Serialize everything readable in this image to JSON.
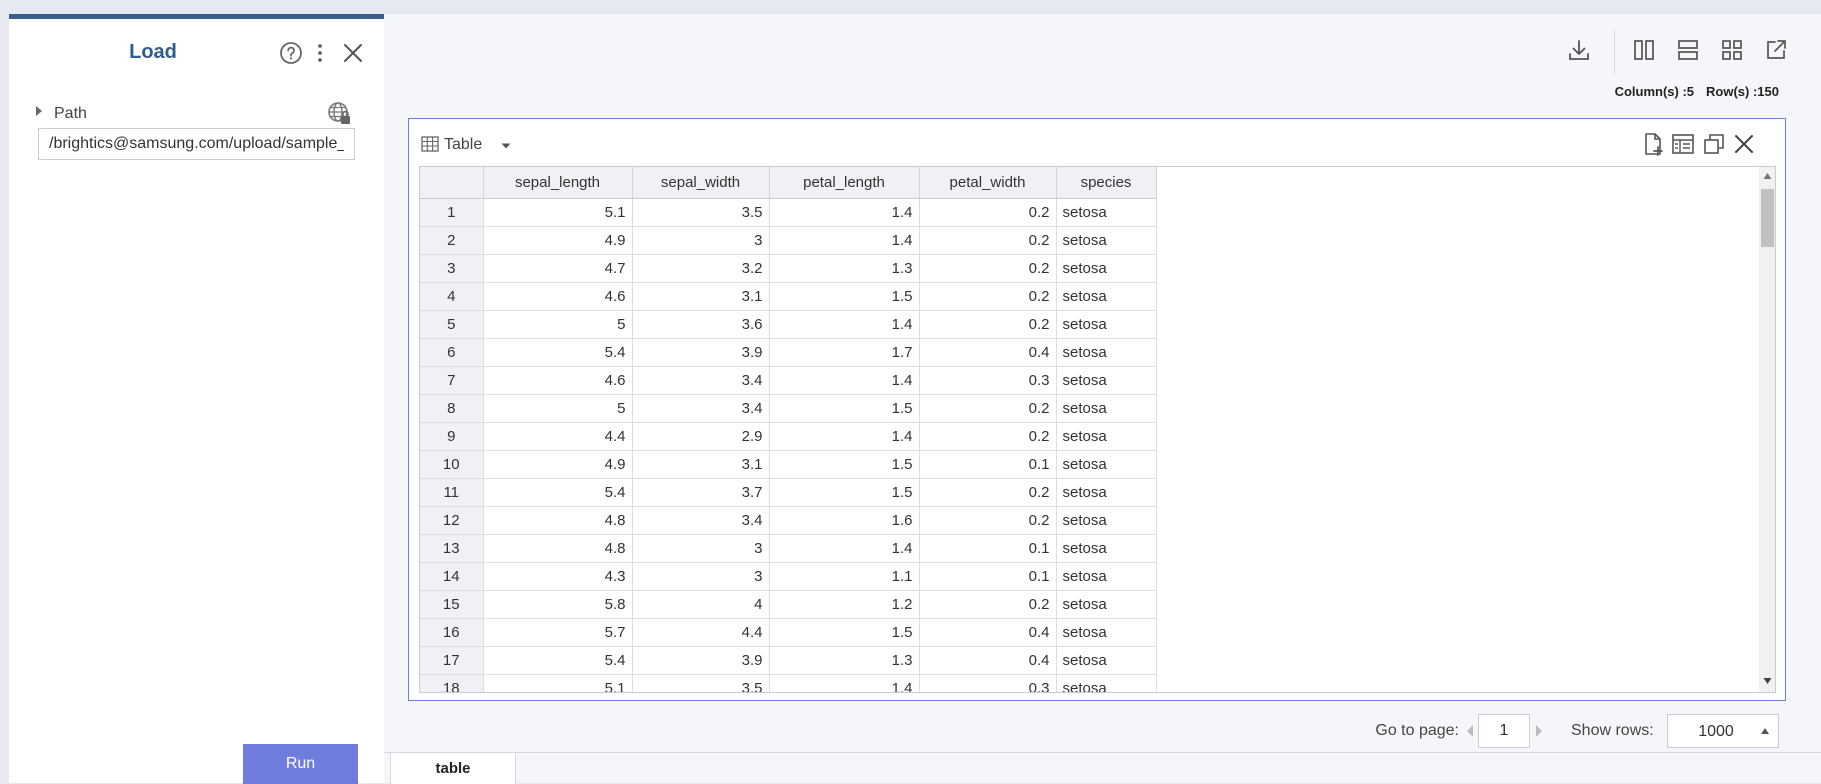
{
  "panel": {
    "title": "Load",
    "path_label": "Path",
    "path_value": "/brightics@samsung.com/upload/sample_iris.csv",
    "run_label": "Run"
  },
  "main": {
    "columns_info": "Column(s) :5",
    "rows_info": "Row(s) :150"
  },
  "table_view": {
    "type_label": "Table",
    "columns": [
      "sepal_length",
      "sepal_width",
      "petal_length",
      "petal_width",
      "species"
    ],
    "rows": [
      [
        "1",
        "5.1",
        "3.5",
        "1.4",
        "0.2",
        "setosa"
      ],
      [
        "2",
        "4.9",
        "3",
        "1.4",
        "0.2",
        "setosa"
      ],
      [
        "3",
        "4.7",
        "3.2",
        "1.3",
        "0.2",
        "setosa"
      ],
      [
        "4",
        "4.6",
        "3.1",
        "1.5",
        "0.2",
        "setosa"
      ],
      [
        "5",
        "5",
        "3.6",
        "1.4",
        "0.2",
        "setosa"
      ],
      [
        "6",
        "5.4",
        "3.9",
        "1.7",
        "0.4",
        "setosa"
      ],
      [
        "7",
        "4.6",
        "3.4",
        "1.4",
        "0.3",
        "setosa"
      ],
      [
        "8",
        "5",
        "3.4",
        "1.5",
        "0.2",
        "setosa"
      ],
      [
        "9",
        "4.4",
        "2.9",
        "1.4",
        "0.2",
        "setosa"
      ],
      [
        "10",
        "4.9",
        "3.1",
        "1.5",
        "0.1",
        "setosa"
      ],
      [
        "11",
        "5.4",
        "3.7",
        "1.5",
        "0.2",
        "setosa"
      ],
      [
        "12",
        "4.8",
        "3.4",
        "1.6",
        "0.2",
        "setosa"
      ],
      [
        "13",
        "4.8",
        "3",
        "1.4",
        "0.1",
        "setosa"
      ],
      [
        "14",
        "4.3",
        "3",
        "1.1",
        "0.1",
        "setosa"
      ],
      [
        "15",
        "5.8",
        "4",
        "1.2",
        "0.2",
        "setosa"
      ],
      [
        "16",
        "5.7",
        "4.4",
        "1.5",
        "0.4",
        "setosa"
      ],
      [
        "17",
        "5.4",
        "3.9",
        "1.3",
        "0.4",
        "setosa"
      ],
      [
        "18",
        "5.1",
        "3.5",
        "1.4",
        "0.3",
        "setosa"
      ]
    ]
  },
  "pager": {
    "goto_label": "Go to page:",
    "page_value": "1",
    "rows_label": "Show rows:",
    "rows_value": "1000"
  },
  "tabs": [
    "table"
  ],
  "colors": {
    "accent": "#6f7bdd",
    "panel_top_bar": "#3d5f8a",
    "title": "#2e5d8e",
    "card_border": "#6e7ce6"
  }
}
